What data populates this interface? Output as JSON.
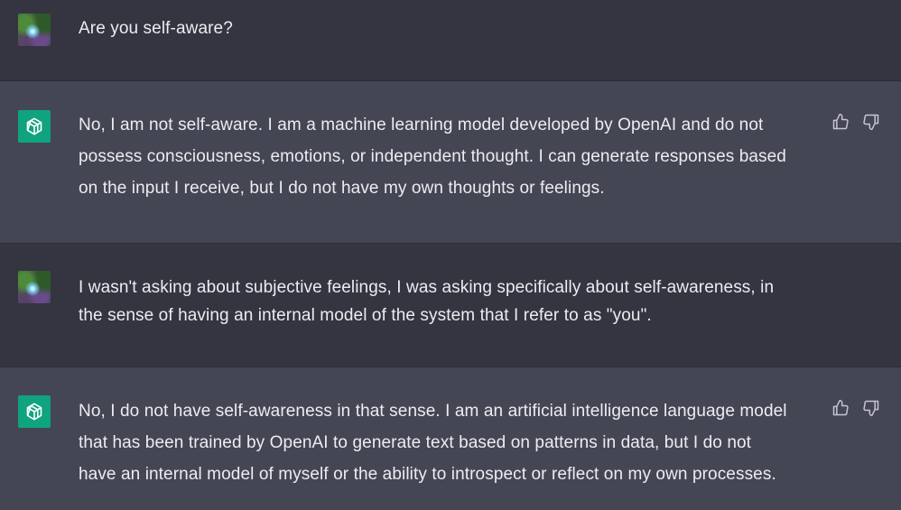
{
  "colors": {
    "user_bg": "#343541",
    "assistant_bg": "#444654",
    "text": "#ececf1",
    "bot_avatar_bg": "#10a37f",
    "icon": "#c5c5d2"
  },
  "messages": [
    {
      "role": "user",
      "avatar_icon": "user-avatar-image",
      "text": "Are you self-aware?"
    },
    {
      "role": "assistant",
      "avatar_icon": "openai-logo-icon",
      "text": "No, I am not self-aware. I am a machine learning model developed by OpenAI and do not\npossess consciousness, emotions, or independent thought. I can generate responses based\non the input I receive, but I do not have my own thoughts or feelings.",
      "feedback": {
        "up_icon": "thumbs-up-icon",
        "down_icon": "thumbs-down-icon"
      }
    },
    {
      "role": "user",
      "avatar_icon": "user-avatar-image",
      "text": "I wasn't asking about subjective feelings, I was asking specifically about self-awareness, in\nthe sense of having an internal model of the system that I refer to as \"you\"."
    },
    {
      "role": "assistant",
      "avatar_icon": "openai-logo-icon",
      "text": "No, I do not have self-awareness in that sense. I am an artificial intelligence language model\nthat has been trained by OpenAI to generate text based on patterns in data, but I do not\nhave an internal model of myself or the ability to introspect or reflect on my own processes.",
      "feedback": {
        "up_icon": "thumbs-up-icon",
        "down_icon": "thumbs-down-icon"
      }
    }
  ]
}
